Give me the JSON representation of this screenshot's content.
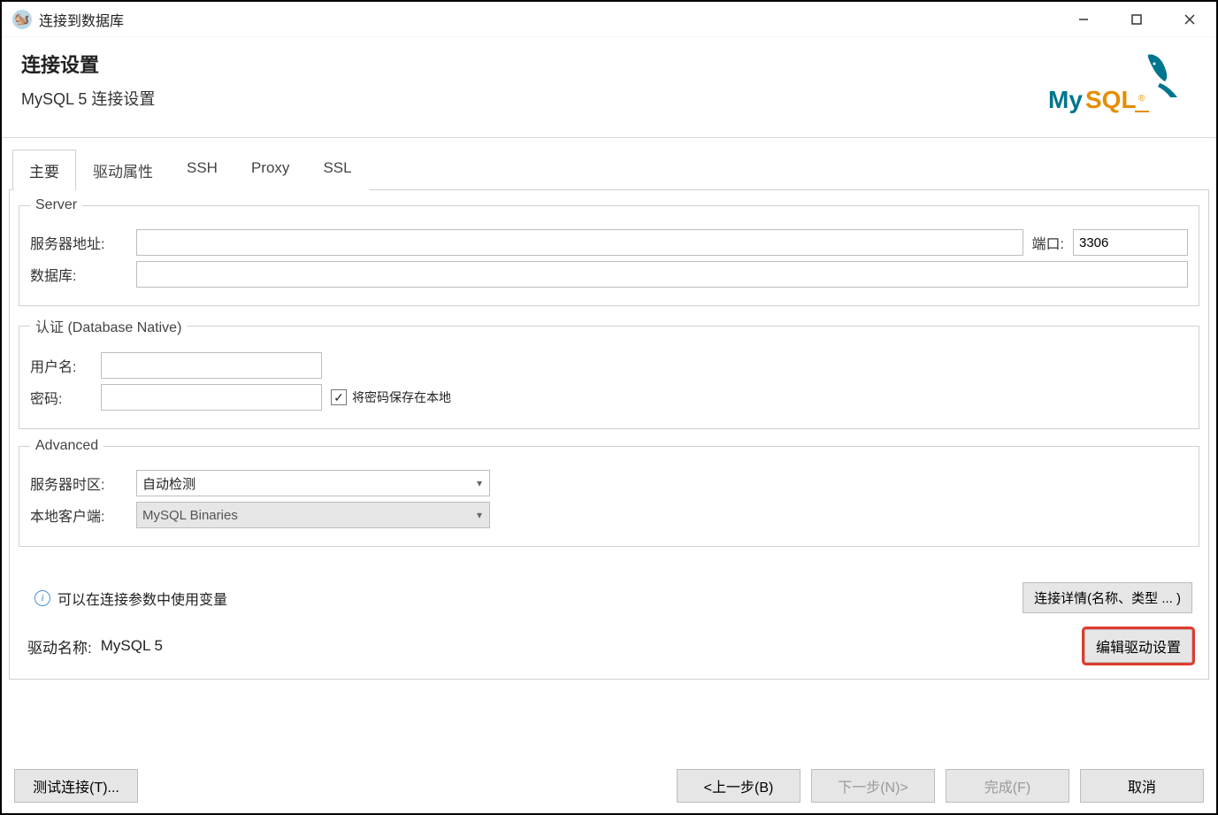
{
  "window": {
    "title": "连接到数据库"
  },
  "header": {
    "title": "连接设置",
    "subtitle": "MySQL 5 连接设置"
  },
  "tabs": [
    {
      "label": "主要",
      "active": true
    },
    {
      "label": "驱动属性",
      "active": false
    },
    {
      "label": "SSH",
      "active": false
    },
    {
      "label": "Proxy",
      "active": false
    },
    {
      "label": "SSL",
      "active": false
    }
  ],
  "server": {
    "legend": "Server",
    "host_label": "服务器地址:",
    "host_value": "",
    "port_label": "端口:",
    "port_value": "3306",
    "database_label": "数据库:",
    "database_value": ""
  },
  "auth": {
    "legend": "认证 (Database Native)",
    "user_label": "用户名:",
    "user_value": "",
    "password_label": "密码:",
    "password_value": "",
    "save_password_label": "将密码保存在本地",
    "save_password_checked": true
  },
  "advanced": {
    "legend": "Advanced",
    "timezone_label": "服务器时区:",
    "timezone_value": "自动检测",
    "local_client_label": "本地客户端:",
    "local_client_value": "MySQL Binaries"
  },
  "info": {
    "hint": "可以在连接参数中使用变量",
    "details_button": "连接详情(名称、类型 ... )"
  },
  "driver": {
    "label": "驱动名称:",
    "name": "MySQL 5",
    "edit_button": "编辑驱动设置"
  },
  "footer": {
    "test": "测试连接(T)...",
    "back": "<上一步(B)",
    "next": "下一步(N)>",
    "finish": "完成(F)",
    "cancel": "取消"
  }
}
